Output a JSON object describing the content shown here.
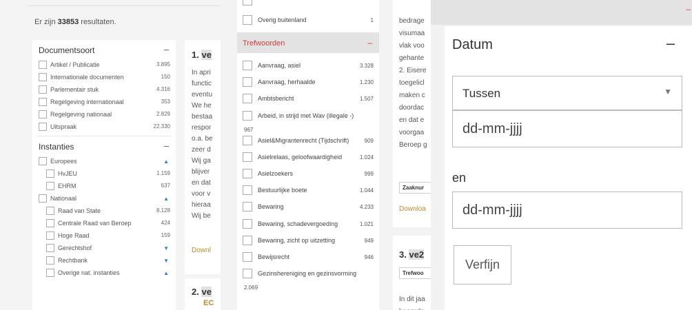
{
  "pane1": {
    "results_prefix": "Er zijn",
    "results_count": "33853",
    "results_suffix": "resultaten.",
    "documentsoort": {
      "title": "Documentsoort",
      "toggle": "–",
      "items": [
        {
          "label": "Artikel / Publicatie",
          "count": "3.895"
        },
        {
          "label": "Internationale documenten",
          "count": "150"
        },
        {
          "label": "Parlementair stuk",
          "count": "4.316"
        },
        {
          "label": "Regelgeving internationaal",
          "count": "353"
        },
        {
          "label": "Regelgeving nationaal",
          "count": "2.829"
        },
        {
          "label": "Uitspraak",
          "count": "22.330"
        }
      ]
    },
    "instanties": {
      "title": "Instanties",
      "toggle": "–",
      "groups": [
        {
          "label": "Europees",
          "arrow": "▲",
          "children": [
            {
              "label": "HvJEU",
              "count": "1.159"
            },
            {
              "label": "EHRM",
              "count": "637"
            }
          ]
        },
        {
          "label": "Nationaal",
          "arrow": "▲",
          "children": [
            {
              "label": "Raad van State",
              "count": "8.128"
            },
            {
              "label": "Centrale Raad van Beroep",
              "count": "424"
            },
            {
              "label": "Hoge Raad",
              "count": "159"
            },
            {
              "label": "Gerechtshof",
              "arrow": "▼"
            },
            {
              "label": "Rechtbank",
              "arrow": "▼"
            },
            {
              "label": "Overige nat. instanties",
              "arrow": "▲"
            }
          ]
        }
      ]
    },
    "result1": {
      "number": "1.",
      "title_fragment": "ve",
      "lines": [
        "In apri",
        "functic",
        "eventu",
        "We he",
        "bestaa",
        "respor",
        "o.a. be",
        "zeer d",
        "Wij ga",
        "blijver",
        "en dat",
        "voor v",
        "hieraa",
        "Wij be"
      ],
      "download": "Downl"
    },
    "result2": {
      "number": "2.",
      "title_fragment": "ve",
      "sub": "EC"
    }
  },
  "pane2": {
    "top_item": {
      "label": "Overig buitenland",
      "count": "1"
    },
    "header": {
      "title": "Trefwoorden",
      "toggle": "–"
    },
    "items": [
      {
        "label": "Aanvraag, asiel",
        "count": "3.328"
      },
      {
        "label": "Aanvraag, herhaalde",
        "count": "1.230"
      },
      {
        "label": "Ambtsbericht",
        "count": "1.507"
      },
      {
        "label": "Arbeid, in strijd met Wav (illegale -)",
        "count": "967"
      },
      {
        "label": "Asiel&Migrantenrecht (Tijdschrift)",
        "count": "909"
      },
      {
        "label": "Asielrelaas, geloofwaardigheid",
        "count": "1.024"
      },
      {
        "label": "Asielzoekers",
        "count": "999"
      },
      {
        "label": "Bestuurlijke boete",
        "count": "1.044"
      },
      {
        "label": "Bewaring",
        "count": "4.233"
      },
      {
        "label": "Bewaring, schadevergoeding",
        "count": "1.021"
      },
      {
        "label": "Bewaring, zicht op uitzetting",
        "count": "949"
      },
      {
        "label": "Bewijsrecht",
        "count": "946"
      },
      {
        "label": "Gezinshereniging en gezinsvorming",
        "count": "2.069"
      }
    ]
  },
  "pane3": {
    "lines": [
      "bedrage",
      "visumaa",
      "vlak voo",
      "gehante",
      "2. Eisere",
      "toegelicl",
      "maken c",
      "doordac",
      "en dat e",
      "voorgaa",
      "Beroep g"
    ],
    "tag": "Zaaknur",
    "download": "Downloa",
    "result3": {
      "number": "3.",
      "title_fragment": "ve2",
      "tag": "Trefwoo",
      "lines": [
        "In dit jaa",
        "beoorde"
      ]
    }
  },
  "pane4": {
    "top_toggle": "–",
    "title": "Datum",
    "toggle": "–",
    "select_value": "Tussen",
    "select_arrow": "▼",
    "date_from_placeholder": "dd-mm-jjjj",
    "and_label": "en",
    "date_to_placeholder": "dd-mm-jjjj",
    "submit": "Verfijn"
  }
}
